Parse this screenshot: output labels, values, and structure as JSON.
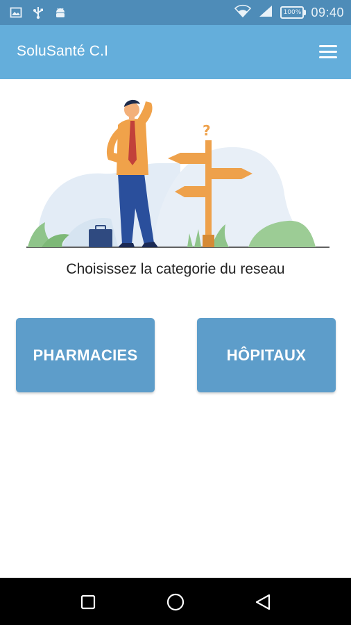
{
  "status_bar": {
    "time": "09:40",
    "battery": "100%",
    "icons": [
      "image-icon",
      "usb-icon",
      "android-icon",
      "wifi-icon",
      "signal-icon",
      "battery-icon"
    ]
  },
  "app_bar": {
    "title": "SoluSanté C.I",
    "menu_icon": "hamburger-menu-icon"
  },
  "main": {
    "illustration": "person-at-signpost-illustration",
    "prompt": "Choisissez la categorie du reseau",
    "buttons": [
      {
        "label": "PHARMACIES"
      },
      {
        "label": "HÔPITAUX"
      }
    ]
  },
  "nav_bar": {
    "icons": [
      "recent-apps-icon",
      "home-icon",
      "back-icon"
    ]
  },
  "colors": {
    "status_bar": "#4e8cb8",
    "app_bar": "#64aedb",
    "button": "#5d9dca",
    "nav_bar": "#000000"
  }
}
